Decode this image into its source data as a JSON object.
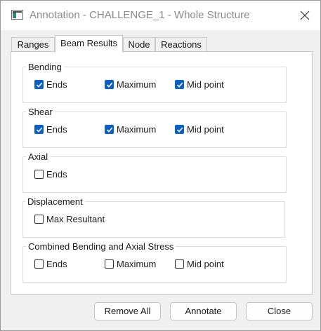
{
  "window": {
    "title": "Annotation - CHALLENGE_1 - Whole Structure"
  },
  "tabs": [
    {
      "label": "Ranges",
      "active": false
    },
    {
      "label": "Beam Results",
      "active": true
    },
    {
      "label": "Node",
      "active": false
    },
    {
      "label": "Reactions",
      "active": false
    }
  ],
  "groups": {
    "bending": {
      "title": "Bending",
      "options": [
        {
          "label": "Ends",
          "checked": true
        },
        {
          "label": "Maximum",
          "checked": true
        },
        {
          "label": "Mid point",
          "checked": true
        }
      ]
    },
    "shear": {
      "title": "Shear",
      "options": [
        {
          "label": "Ends",
          "checked": true
        },
        {
          "label": "Maximum",
          "checked": true
        },
        {
          "label": "Mid point",
          "checked": true
        }
      ]
    },
    "axial": {
      "title": "Axial",
      "options": [
        {
          "label": "Ends",
          "checked": false
        }
      ]
    },
    "displacement": {
      "title": "Displacement",
      "options": [
        {
          "label": "Max Resultant",
          "checked": false
        }
      ]
    },
    "combined": {
      "title": "Combined Bending and Axial Stress",
      "options": [
        {
          "label": "Ends",
          "checked": false
        },
        {
          "label": "Maximum",
          "checked": false
        },
        {
          "label": "Mid point",
          "checked": false
        }
      ]
    }
  },
  "buttons": {
    "remove_all": "Remove All",
    "annotate": "Annotate",
    "close": "Close"
  },
  "colors": {
    "accent": "#0a5fc7",
    "title_text": "#8a8a8a",
    "background_line": "#2b3fc6"
  },
  "icons": {
    "app": "app-window-icon",
    "close": "close-icon",
    "check": "check-icon"
  }
}
